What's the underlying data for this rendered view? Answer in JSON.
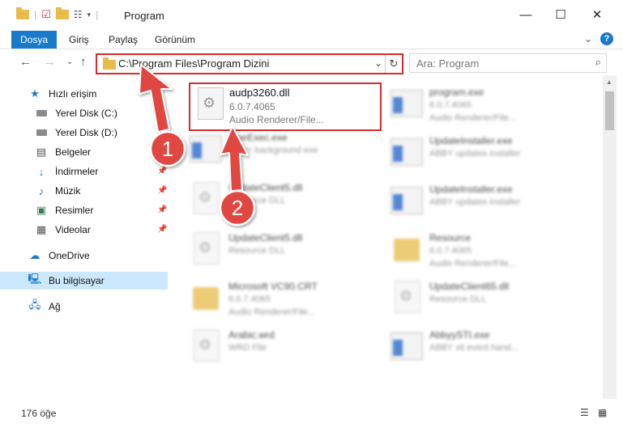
{
  "window": {
    "title": "Program"
  },
  "ribbon": {
    "tabs": [
      "Dosya",
      "Giriş",
      "Paylaş",
      "Görünüm"
    ]
  },
  "address": {
    "path": "C:\\Program Files\\Program Dizini"
  },
  "search": {
    "placeholder": "Ara: Program"
  },
  "sidebar": {
    "quick_access": "Hızlı erişim",
    "items": [
      {
        "label": "Yerel Disk (C:)",
        "icon": "drive-icon",
        "pinned": true
      },
      {
        "label": "Yerel Disk (D:)",
        "icon": "drive-icon",
        "pinned": true
      },
      {
        "label": "Belgeler",
        "icon": "documents-icon",
        "pinned": true
      },
      {
        "label": "İndirmeler",
        "icon": "download-icon",
        "pinned": true
      },
      {
        "label": "Müzik",
        "icon": "music-icon",
        "pinned": true
      },
      {
        "label": "Resimler",
        "icon": "pictures-icon",
        "pinned": true
      },
      {
        "label": "Videolar",
        "icon": "videos-icon",
        "pinned": true
      }
    ],
    "onedrive": "OneDrive",
    "this_pc": "Bu bilgisayar",
    "network": "Ağ"
  },
  "files": {
    "highlighted": {
      "name": "audp3260.dll",
      "version": "6.0.7.4065",
      "desc": "Audio Renderer/File..."
    },
    "others": [
      {
        "name": "program.exe",
        "l2": "6.0.7.4065",
        "l3": "Audio Renderer/File...",
        "type": "exe"
      },
      {
        "name": "FineExec.exe",
        "l2": "ABBY background exe",
        "l3": "",
        "type": "exe"
      },
      {
        "name": "UpdateInstaller.exe",
        "l2": "ABBY updates installer",
        "l3": "",
        "type": "exe"
      },
      {
        "name": "UpdateClient5.dll",
        "l2": "Resource DLL",
        "l3": "",
        "type": "dll"
      },
      {
        "name": "UpdateInstaller.exe",
        "l2": "ABBY updates installer",
        "l3": "",
        "type": "exe"
      },
      {
        "name": "UpdateClient5.dll",
        "l2": "Resource DLL",
        "l3": "",
        "type": "dll"
      },
      {
        "name": "Resource",
        "l2": "6.0.7.4065",
        "l3": "Audio Renderer/File...",
        "type": "folder"
      },
      {
        "name": "Microsoft VC90.CRT",
        "l2": "6.0.7.4065",
        "l3": "Audio Renderer/File...",
        "type": "folder"
      },
      {
        "name": "UpdateClient65.dll",
        "l2": "Resource DLL",
        "l3": "",
        "type": "dll"
      },
      {
        "name": "Arabic.wrd",
        "l2": "WRD File",
        "l3": "",
        "type": "dll"
      },
      {
        "name": "AbbyySTI.exe",
        "l2": "ABBY sti event hand...",
        "l3": "",
        "type": "exe"
      }
    ]
  },
  "annotations": {
    "arrow1": "1",
    "arrow2": "2"
  },
  "status": {
    "count": "176 öğe"
  },
  "colors": {
    "accent": "#1979ca",
    "highlight": "#d72a2a",
    "selected": "#cce8ff"
  }
}
